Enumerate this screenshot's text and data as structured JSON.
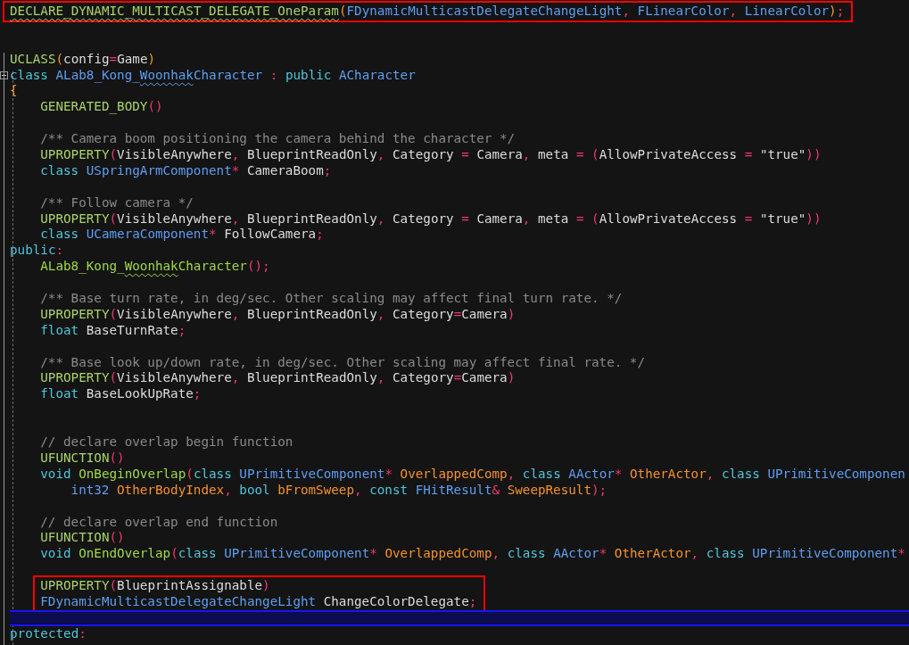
{
  "editor": {
    "lines": [
      {
        "current": false,
        "boxed": true,
        "tokens": [
          {
            "kind": "macro",
            "text": "DECLARE_DYNAMIC_MULTICAST_DELEGATE_OneParam",
            "squiggle": true
          },
          {
            "kind": "bracket",
            "text": "("
          },
          {
            "kind": "type",
            "text": "FDynamicMulticastDelegateChangeLight"
          },
          {
            "kind": "punct",
            "text": ", "
          },
          {
            "kind": "type",
            "text": "FLinearColor"
          },
          {
            "kind": "punct",
            "text": ", "
          },
          {
            "kind": "type",
            "text": "LinearColor"
          },
          {
            "kind": "bracket",
            "text": ")"
          },
          {
            "kind": "punct",
            "text": ";"
          }
        ]
      },
      {
        "current": false
      },
      {
        "current": false
      },
      {
        "current": false,
        "tokens": [
          {
            "kind": "macro",
            "text": "UCLASS"
          },
          {
            "kind": "bracket",
            "text": "("
          },
          {
            "kind": "plain",
            "text": "config"
          },
          {
            "kind": "punct",
            "text": "="
          },
          {
            "kind": "plain",
            "text": "Game"
          },
          {
            "kind": "bracket",
            "text": ")"
          }
        ]
      },
      {
        "current": false,
        "expanded": true,
        "tokens": [
          {
            "kind": "keyword",
            "text": "class "
          },
          {
            "kind": "type",
            "text": "ALab8_Kong_"
          },
          {
            "kind": "type",
            "text": "Woonhak",
            "squiggle": true
          },
          {
            "kind": "type",
            "text": "Character"
          },
          {
            "kind": "punct",
            "text": " : "
          },
          {
            "kind": "keyword",
            "text": "public "
          },
          {
            "kind": "type",
            "text": "ACharacter"
          }
        ]
      },
      {
        "current": false,
        "tokens": [
          {
            "kind": "bracket",
            "text": "{"
          }
        ],
        "children": [
          {
            "current": false,
            "tokens": [
              {
                "kind": "macro",
                "text": "GENERATED_BODY"
              },
              {
                "kind": "punct",
                "text": "()"
              }
            ]
          },
          {
            "current": false
          },
          {
            "current": false,
            "tokens": [
              {
                "kind": "comment",
                "text": "/** Camera boom positioning the camera behind the character */"
              }
            ]
          },
          {
            "current": false,
            "tokens": [
              {
                "kind": "macro",
                "text": "UPROPERTY"
              },
              {
                "kind": "punct",
                "text": "("
              },
              {
                "kind": "plain",
                "text": "VisibleAnywhere"
              },
              {
                "kind": "punct",
                "text": ", "
              },
              {
                "kind": "plain",
                "text": "BlueprintReadOnly"
              },
              {
                "kind": "punct",
                "text": ", "
              },
              {
                "kind": "plain",
                "text": "Category "
              },
              {
                "kind": "punct",
                "text": "= "
              },
              {
                "kind": "plain",
                "text": "Camera"
              },
              {
                "kind": "punct",
                "text": ", "
              },
              {
                "kind": "plain",
                "text": "meta "
              },
              {
                "kind": "punct",
                "text": "= ("
              },
              {
                "kind": "plain",
                "text": "AllowPrivateAccess "
              },
              {
                "kind": "punct",
                "text": "= "
              },
              {
                "kind": "plain",
                "text": "\"true\""
              },
              {
                "kind": "punct",
                "text": "))"
              }
            ]
          },
          {
            "current": false,
            "tokens": [
              {
                "kind": "keyword",
                "text": "class "
              },
              {
                "kind": "type",
                "text": "USpringArmComponent"
              },
              {
                "kind": "punct",
                "text": "* "
              },
              {
                "kind": "plain",
                "text": "CameraBoom"
              },
              {
                "kind": "punct",
                "text": ";"
              }
            ]
          },
          {
            "current": false
          },
          {
            "current": false,
            "tokens": [
              {
                "kind": "comment",
                "text": "/** Follow camera */"
              }
            ]
          },
          {
            "current": false,
            "tokens": [
              {
                "kind": "macro",
                "text": "UPROPERTY"
              },
              {
                "kind": "punct",
                "text": "("
              },
              {
                "kind": "plain",
                "text": "VisibleAnywhere"
              },
              {
                "kind": "punct",
                "text": ", "
              },
              {
                "kind": "plain",
                "text": "BlueprintReadOnly"
              },
              {
                "kind": "punct",
                "text": ", "
              },
              {
                "kind": "plain",
                "text": "Category "
              },
              {
                "kind": "punct",
                "text": "= "
              },
              {
                "kind": "plain",
                "text": "Camera"
              },
              {
                "kind": "punct",
                "text": ", "
              },
              {
                "kind": "plain",
                "text": "meta "
              },
              {
                "kind": "punct",
                "text": "= ("
              },
              {
                "kind": "plain",
                "text": "AllowPrivateAccess "
              },
              {
                "kind": "punct",
                "text": "= "
              },
              {
                "kind": "plain",
                "text": "\"true\""
              },
              {
                "kind": "punct",
                "text": "))"
              }
            ]
          },
          {
            "current": false,
            "tokens": [
              {
                "kind": "keyword",
                "text": "class "
              },
              {
                "kind": "type",
                "text": "UCameraComponent"
              },
              {
                "kind": "punct",
                "text": "* "
              },
              {
                "kind": "plain",
                "text": "FollowCamera"
              },
              {
                "kind": "punct",
                "text": ";"
              }
            ]
          }
        ]
      },
      {
        "current": false,
        "tokens": [
          {
            "kind": "keyword",
            "text": "public"
          },
          {
            "kind": "punct",
            "text": ":"
          }
        ],
        "children": [
          {
            "current": false,
            "tokens": [
              {
                "kind": "func",
                "text": "ALab8_Kong_"
              },
              {
                "kind": "func",
                "text": "Woonhak",
                "squiggle": true
              },
              {
                "kind": "func",
                "text": "Character"
              },
              {
                "kind": "punct",
                "text": "();"
              }
            ]
          },
          {
            "current": false
          },
          {
            "current": false,
            "tokens": [
              {
                "kind": "comment",
                "text": "/** Base turn rate, in deg/sec. Other scaling may affect final turn rate. */"
              }
            ]
          },
          {
            "current": false,
            "tokens": [
              {
                "kind": "macro",
                "text": "UPROPERTY"
              },
              {
                "kind": "punct",
                "text": "("
              },
              {
                "kind": "plain",
                "text": "VisibleAnywhere"
              },
              {
                "kind": "punct",
                "text": ", "
              },
              {
                "kind": "plain",
                "text": "BlueprintReadOnly"
              },
              {
                "kind": "punct",
                "text": ", "
              },
              {
                "kind": "plain",
                "text": "Category"
              },
              {
                "kind": "punct",
                "text": "="
              },
              {
                "kind": "plain",
                "text": "Camera"
              },
              {
                "kind": "punct",
                "text": ")"
              }
            ]
          },
          {
            "current": false,
            "tokens": [
              {
                "kind": "keyword",
                "text": "float "
              },
              {
                "kind": "plain",
                "text": "BaseTurnRate"
              },
              {
                "kind": "punct",
                "text": ";"
              }
            ]
          },
          {
            "current": false
          },
          {
            "current": false,
            "tokens": [
              {
                "kind": "comment",
                "text": "/** Base look up/down rate, in deg/sec. Other scaling may affect final rate. */"
              }
            ]
          },
          {
            "current": false,
            "tokens": [
              {
                "kind": "macro",
                "text": "UPROPERTY"
              },
              {
                "kind": "punct",
                "text": "("
              },
              {
                "kind": "plain",
                "text": "VisibleAnywhere"
              },
              {
                "kind": "punct",
                "text": ", "
              },
              {
                "kind": "plain",
                "text": "BlueprintReadOnly"
              },
              {
                "kind": "punct",
                "text": ", "
              },
              {
                "kind": "plain",
                "text": "Category"
              },
              {
                "kind": "punct",
                "text": "="
              },
              {
                "kind": "plain",
                "text": "Camera"
              },
              {
                "kind": "punct",
                "text": ")"
              }
            ]
          },
          {
            "current": false,
            "tokens": [
              {
                "kind": "keyword",
                "text": "float "
              },
              {
                "kind": "plain",
                "text": "BaseLookUpRate"
              },
              {
                "kind": "punct",
                "text": ";"
              }
            ]
          },
          {
            "current": false
          },
          {
            "current": false
          },
          {
            "current": false,
            "tokens": [
              {
                "kind": "comment",
                "text": "// declare overlap begin function"
              }
            ]
          },
          {
            "current": false,
            "tokens": [
              {
                "kind": "macro",
                "text": "UFUNCTION"
              },
              {
                "kind": "punct",
                "text": "()"
              }
            ]
          },
          {
            "current": false,
            "tokens": [
              {
                "kind": "keyword",
                "text": "void "
              },
              {
                "kind": "func",
                "text": "OnBeginOverlap"
              },
              {
                "kind": "punct",
                "text": "("
              },
              {
                "kind": "keyword",
                "text": "class "
              },
              {
                "kind": "type",
                "text": "UPrimitiveComponent"
              },
              {
                "kind": "punct",
                "text": "* "
              },
              {
                "kind": "param",
                "text": "OverlappedComp"
              },
              {
                "kind": "punct",
                "text": ", "
              },
              {
                "kind": "keyword",
                "text": "class "
              },
              {
                "kind": "type",
                "text": "AActor"
              },
              {
                "kind": "punct",
                "text": "* "
              },
              {
                "kind": "param",
                "text": "OtherActor"
              },
              {
                "kind": "punct",
                "text": ", "
              },
              {
                "kind": "keyword",
                "text": "class "
              },
              {
                "kind": "type",
                "text": "UPrimitiveComponen"
              }
            ],
            "children": [
              {
                "current": false,
                "tokens": [
                  {
                    "kind": "type",
                    "text": "int32 "
                  },
                  {
                    "kind": "param",
                    "text": "OtherBodyIndex"
                  },
                  {
                    "kind": "punct",
                    "text": ", "
                  },
                  {
                    "kind": "keyword",
                    "text": "bool "
                  },
                  {
                    "kind": "param",
                    "text": "bFromSweep"
                  },
                  {
                    "kind": "punct",
                    "text": ", "
                  },
                  {
                    "kind": "keyword",
                    "text": "const "
                  },
                  {
                    "kind": "type",
                    "text": "FHitResult"
                  },
                  {
                    "kind": "punct",
                    "text": "& "
                  },
                  {
                    "kind": "param",
                    "text": "SweepResult"
                  },
                  {
                    "kind": "punct",
                    "text": ");"
                  }
                ]
              }
            ]
          },
          {
            "current": false
          },
          {
            "current": false,
            "tokens": [
              {
                "kind": "comment",
                "text": "// declare overlap end function"
              }
            ]
          },
          {
            "current": false,
            "tokens": [
              {
                "kind": "macro",
                "text": "UFUNCTION"
              },
              {
                "kind": "punct",
                "text": "()"
              }
            ]
          },
          {
            "current": false,
            "tokens": [
              {
                "kind": "keyword",
                "text": "void "
              },
              {
                "kind": "func",
                "text": "OnEndOverlap"
              },
              {
                "kind": "punct",
                "text": "("
              },
              {
                "kind": "keyword",
                "text": "class "
              },
              {
                "kind": "type",
                "text": "UPrimitiveComponent"
              },
              {
                "kind": "punct",
                "text": "* "
              },
              {
                "kind": "param",
                "text": "OverlappedComp"
              },
              {
                "kind": "punct",
                "text": ", "
              },
              {
                "kind": "keyword",
                "text": "class "
              },
              {
                "kind": "type",
                "text": "AActor"
              },
              {
                "kind": "punct",
                "text": "* "
              },
              {
                "kind": "param",
                "text": "OtherActor"
              },
              {
                "kind": "punct",
                "text": ", "
              },
              {
                "kind": "keyword",
                "text": "class "
              },
              {
                "kind": "type",
                "text": "UPrimitiveComponent"
              },
              {
                "kind": "punct",
                "text": "*"
              }
            ]
          },
          {
            "current": false
          },
          {
            "current": false,
            "boxed": true,
            "tokens": [
              {
                "kind": "macro",
                "text": "UPROPERTY"
              },
              {
                "kind": "punct",
                "text": "("
              },
              {
                "kind": "plain",
                "text": "BlueprintAssignable"
              },
              {
                "kind": "punct",
                "text": ")"
              }
            ]
          },
          {
            "current": false,
            "boxed": true,
            "tokens": [
              {
                "kind": "type",
                "text": "FDynamicMulticastDelegateChangeLight"
              },
              {
                "kind": "plain",
                "text": " ChangeColorDelegate"
              },
              {
                "kind": "punct",
                "text": ";"
              }
            ]
          },
          {
            "current": true
          }
        ]
      },
      {
        "current": false,
        "tokens": [
          {
            "kind": "keyword",
            "text": "protected"
          },
          {
            "kind": "punct",
            "text": ":"
          }
        ]
      }
    ]
  }
}
